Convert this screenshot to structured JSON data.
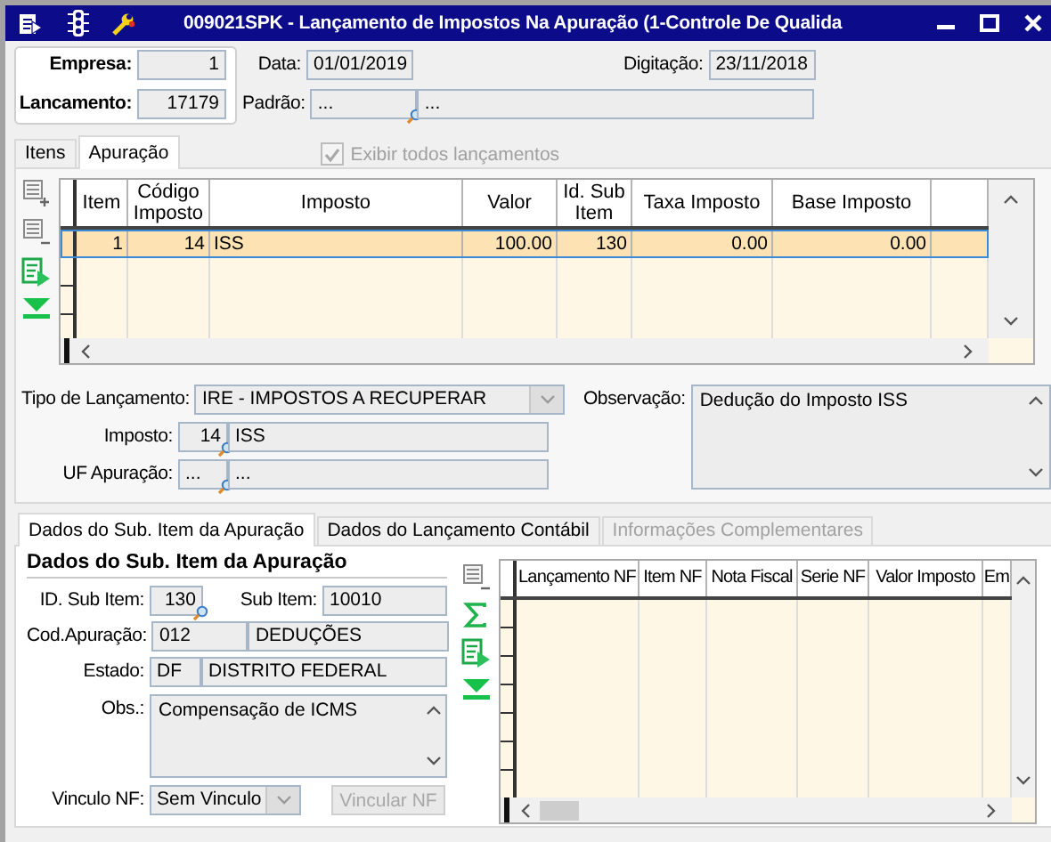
{
  "window": {
    "title": "009021SPK - Lançamento de Impostos Na Apuração (1-Controle De Qualida"
  },
  "header": {
    "empresa": {
      "label": "Empresa:",
      "value": "1"
    },
    "lancamento": {
      "label": "Lancamento:",
      "value": "17179"
    },
    "data": {
      "label": "Data:",
      "value": "01/01/2019"
    },
    "digitacao": {
      "label": "Digitação:",
      "value": "23/11/2018"
    },
    "padrao": {
      "label": "Padrão:",
      "code": "...",
      "description": "..."
    }
  },
  "tabs": [
    {
      "label": "Itens",
      "selected": false
    },
    {
      "label": "Apuração",
      "selected": true
    }
  ],
  "show_all": {
    "label": "Exibir todos lançamentos",
    "checked": true,
    "disabled": true
  },
  "items_grid": {
    "columns": [
      "Item",
      "Código Imposto",
      "Imposto",
      "Valor",
      "Id. Sub Item",
      "Taxa Imposto",
      "Base Imposto"
    ],
    "rows": [
      {
        "cells": [
          "1",
          "14",
          "ISS",
          "100.00",
          "130",
          "0.00",
          "0.00"
        ],
        "selected": true
      }
    ]
  },
  "tipo_lancamento": {
    "label": "Tipo de Lançamento:",
    "value": "IRE - IMPOSTOS A RECUPERAR"
  },
  "imposto": {
    "label": "Imposto:",
    "code": "14",
    "description": "ISS"
  },
  "uf_apuracao": {
    "label": "UF Apuração:",
    "code": "...",
    "description": "..."
  },
  "observacao": {
    "label": "Observação:",
    "value": "Dedução do Imposto ISS"
  },
  "sub_tabs": [
    {
      "label": "Dados do Sub. Item da Apuração",
      "selected": true,
      "disabled": false
    },
    {
      "label": "Dados do Lançamento Contábil",
      "selected": false,
      "disabled": false
    },
    {
      "label": "Informações Complementares",
      "selected": false,
      "disabled": true
    }
  ],
  "sub_item": {
    "title": "Dados do Sub. Item da Apuração",
    "id_sub_item": {
      "label": "ID. Sub Item:",
      "value": "130"
    },
    "sub_item": {
      "label": "Sub Item:",
      "value": "10010"
    },
    "cod_apuracao": {
      "label": "Cod.Apuração:",
      "code": "012",
      "description": "DEDUÇÕES"
    },
    "estado": {
      "label": "Estado:",
      "code": "DF",
      "description": "DISTRITO FEDERAL"
    },
    "obs": {
      "label": "Obs.:",
      "value": "Compensação de ICMS"
    },
    "vinculo_nf": {
      "label": "Vinculo NF:",
      "value": "Sem Vinculo"
    },
    "vincular_button": {
      "label": "Vincular NF",
      "disabled": true
    }
  },
  "nf_grid": {
    "columns": [
      "Lançamento NF",
      "Item NF",
      "Nota Fiscal",
      "Serie NF",
      "Valor Imposto",
      "Em"
    ]
  }
}
